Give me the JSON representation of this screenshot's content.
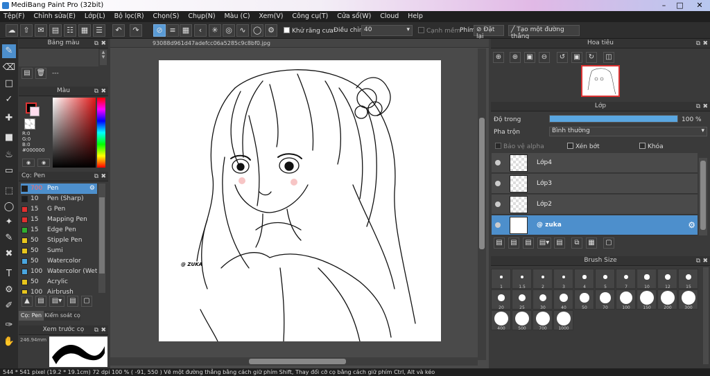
{
  "window": {
    "title": "MediBang Paint Pro (32bit)"
  },
  "menu": [
    "Tệp(F)",
    "Chỉnh sửa(E)",
    "Lớp(L)",
    "Bộ lọc(R)",
    "Chọn(S)",
    "Chụp(N)",
    "Màu (C)",
    "Xem(V)",
    "Công cụ(T)",
    "Cửa sổ(W)",
    "Cloud",
    "Help"
  ],
  "toolbar": {
    "antialias_label": "Khử răng cưa",
    "adjust_label": "Điều chỉnh",
    "adjust_value": "40",
    "canhmem_label": "Cạnh mềm",
    "phim_label": "Phím",
    "reset_label": "Đặt lại",
    "straight_label": "Tạo một đường thẳng"
  },
  "file_tab": "93088d961d47adefcc06a5285c9c8bf0.jpg",
  "panels": {
    "palette_title": "Bảng màu",
    "palette_value": "---",
    "color_title": "Màu",
    "rgb": {
      "r": "R:0",
      "g": "G:0",
      "b": "B:0",
      "hex": "#000000"
    },
    "brush_title": "Cọ: Pen",
    "brush_tab1": "Cọ: Pen",
    "brush_tab2": "Kiểm soát cọ",
    "preview_title": "Xem trước cọ",
    "preview_size": "246.94mm",
    "navigator_title": "Hoa tiêu",
    "layer_title": "Lớp",
    "opacity_label": "Độ trong",
    "opacity_value": "100 %",
    "opacity_fraction": 1.0,
    "blend_label": "Pha trộn",
    "blend_value": "Bình thường",
    "protect_alpha": "Bảo vệ alpha",
    "clip": "Xén bớt",
    "lock": "Khóa",
    "brushsize_title": "Brush Size"
  },
  "brushes": [
    {
      "size": "700",
      "name": "Pen",
      "color": "#1e1e1e",
      "active": true
    },
    {
      "size": "10",
      "name": "Pen (Sharp)",
      "color": "#1e1e1e"
    },
    {
      "size": "15",
      "name": "G Pen",
      "color": "#e03030"
    },
    {
      "size": "15",
      "name": "Mapping Pen",
      "color": "#e03030"
    },
    {
      "size": "15",
      "name": "Edge Pen",
      "color": "#2fae2f"
    },
    {
      "size": "50",
      "name": "Stipple Pen",
      "color": "#e8c51c"
    },
    {
      "size": "50",
      "name": "Sumi",
      "color": "#e8c51c"
    },
    {
      "size": "50",
      "name": "Watercolor",
      "color": "#4aa6e0"
    },
    {
      "size": "100",
      "name": "Watercolor (Wet)",
      "color": "#4aa6e0"
    },
    {
      "size": "50",
      "name": "Acrylic",
      "color": "#e8c51c"
    },
    {
      "size": "100",
      "name": "Airbrush",
      "color": "#e8c51c"
    }
  ],
  "layers": [
    {
      "name": "Lớp4"
    },
    {
      "name": "Lớp3"
    },
    {
      "name": "Lớp2"
    },
    {
      "name": "@ zuka",
      "active": true
    }
  ],
  "brush_sizes": [
    "1",
    "1.5",
    "2",
    "3",
    "4",
    "5",
    "7",
    "10",
    "12",
    "15",
    "20",
    "25",
    "30",
    "40",
    "50",
    "70",
    "100",
    "150",
    "200",
    "300",
    "400",
    "500",
    "700",
    "1000"
  ],
  "canvas": {
    "watermark": "@ ZUKA"
  },
  "status": "544 * 541 pixel   (19.2 * 19.1cm)   72 dpi   100 %   ( -91, 550 )   Vẽ một đường thẳng bằng cách giữ phím Shift, Thay đổi cỡ cọ bằng cách giữ phím Ctrl, Alt và kéo",
  "colors": {
    "accent": "#4d8fcc",
    "bg": "#3a3a3a"
  }
}
